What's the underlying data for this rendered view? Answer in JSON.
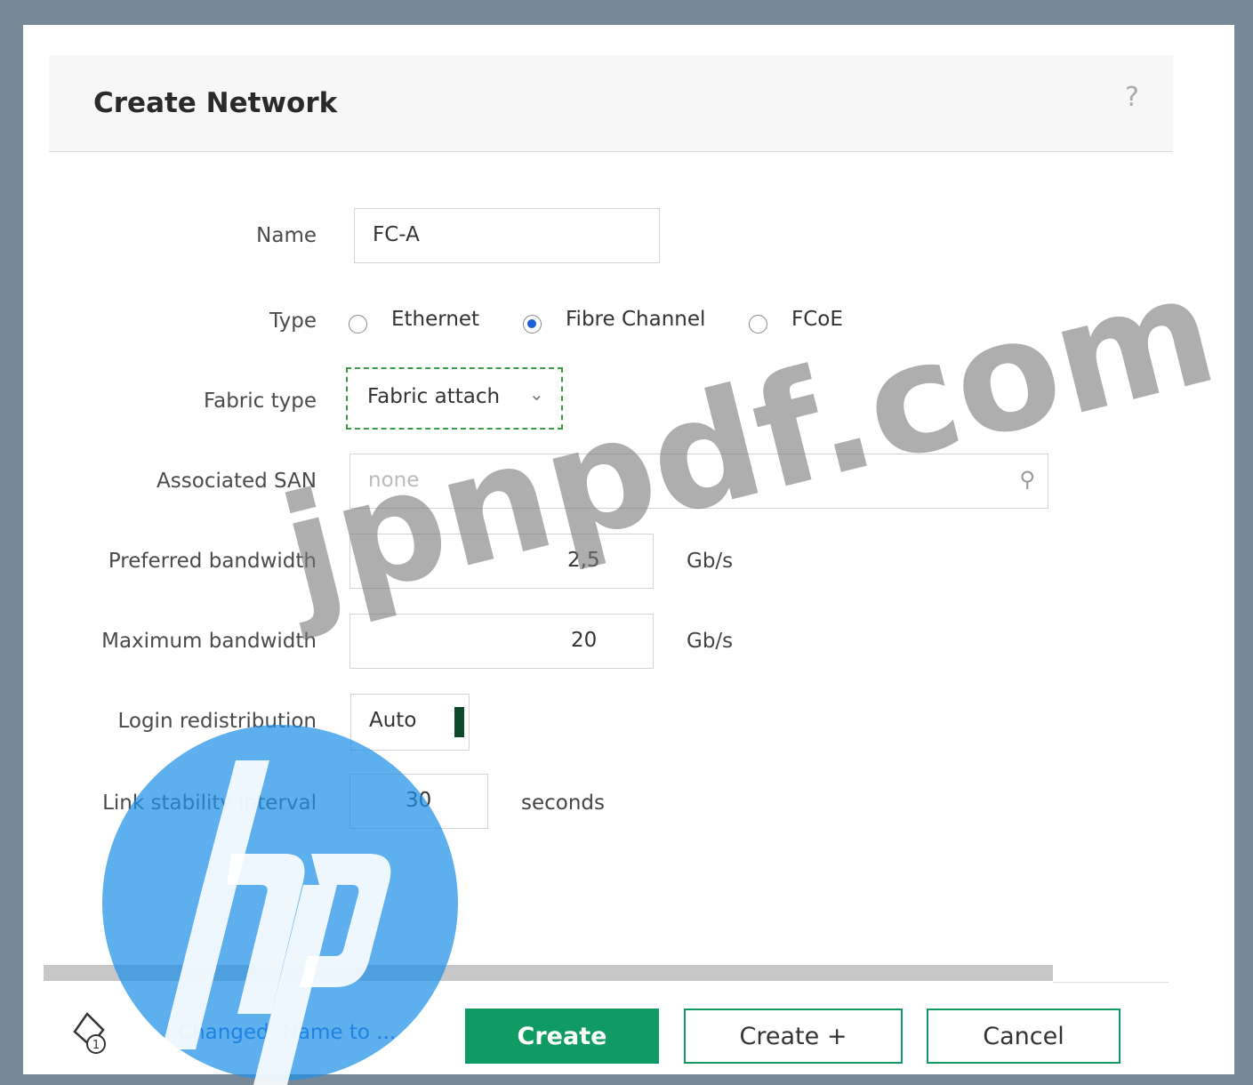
{
  "dialog": {
    "title": "Create Network",
    "help_glyph": "?"
  },
  "form": {
    "name_label": "Name",
    "name_value": "FC-A",
    "type_label": "Type",
    "type_options": [
      "Ethernet",
      "Fibre Channel",
      "FCoE"
    ],
    "type_selected": "Fibre Channel",
    "fabric_type_label": "Fabric type",
    "fabric_type_value": "Fabric attach",
    "associated_san_label": "Associated SAN",
    "associated_san_placeholder": "none",
    "preferred_bw_label": "Preferred bandwidth",
    "preferred_bw_value": "2,5",
    "preferred_bw_unit": "Gb/s",
    "max_bw_label": "Maximum bandwidth",
    "max_bw_value": "20",
    "max_bw_unit": "Gb/s",
    "login_redist_label": "Login redistribution",
    "login_redist_value": "Auto",
    "link_stability_label": "Link stability interval",
    "link_stability_value": "30",
    "link_stability_unit": "seconds"
  },
  "footer": {
    "changes_badge": "1",
    "changed_text": "Changed: Name to ...",
    "create_label": "Create",
    "create_plus_label": "Create +",
    "cancel_label": "Cancel"
  },
  "watermark": "jpnpdf.com",
  "colors": {
    "accent_green": "#0f9b63",
    "radio_selected": "#1a5fd6",
    "link_blue": "#1a5fd6",
    "frame": "#778899"
  }
}
